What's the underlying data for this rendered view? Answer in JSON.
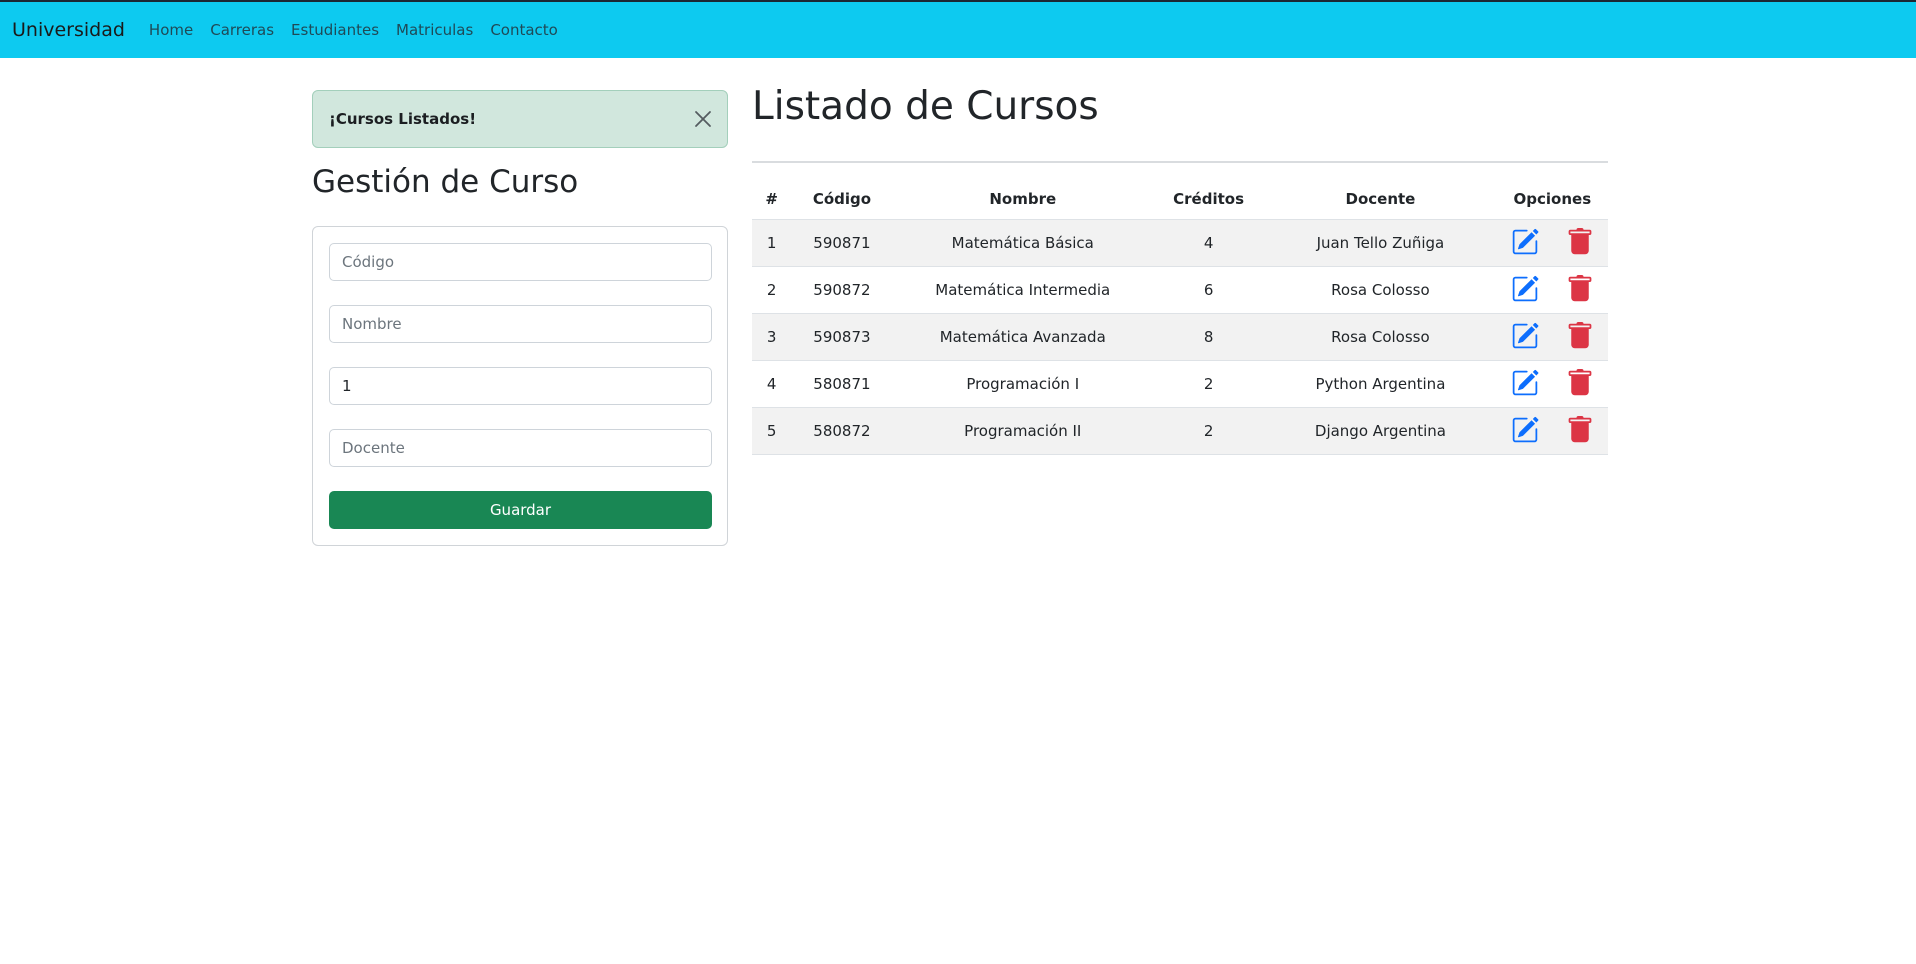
{
  "navbar": {
    "brand": "Universidad",
    "links": [
      "Home",
      "Carreras",
      "Estudiantes",
      "Matriculas",
      "Contacto"
    ]
  },
  "alert": {
    "message": "¡Cursos Listados!"
  },
  "form": {
    "title": "Gestión de Curso",
    "codigo_placeholder": "Código",
    "nombre_placeholder": "Nombre",
    "creditos_value": "1",
    "docente_placeholder": "Docente",
    "save_label": "Guardar"
  },
  "list": {
    "title": "Listado de Cursos",
    "headers": [
      "#",
      "Código",
      "Nombre",
      "Créditos",
      "Docente",
      "Opciones"
    ],
    "rows": [
      [
        "1",
        "590871",
        "Matemática Básica",
        "4",
        "Juan Tello Zuñiga"
      ],
      [
        "2",
        "590872",
        "Matemática Intermedia",
        "6",
        "Rosa Colosso"
      ],
      [
        "3",
        "590873",
        "Matemática Avanzada",
        "8",
        "Rosa Colosso"
      ],
      [
        "4",
        "580871",
        "Programación I",
        "2",
        "Python Argentina"
      ],
      [
        "5",
        "580872",
        "Programación II",
        "2",
        "Django Argentina"
      ]
    ]
  },
  "icons": {
    "edit": "pencil-square-icon",
    "delete": "trash-icon",
    "close": "close-icon"
  },
  "colors": {
    "navbar": "#0dcaf0",
    "alert_bg": "#d1e7dd",
    "save_button": "#198754",
    "edit_icon": "#0d6efd",
    "delete_icon": "#dc3545"
  }
}
